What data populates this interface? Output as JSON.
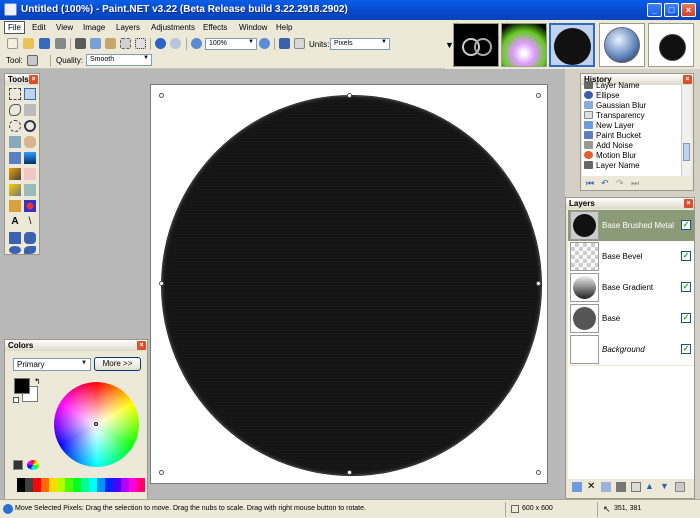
{
  "window": {
    "title": "Untitled (100%) - Paint.NET v3.22 (Beta Release build 3.22.2918.2902)"
  },
  "menu": [
    "File",
    "Edit",
    "View",
    "Image",
    "Layers",
    "Adjustments",
    "Effects",
    "Window",
    "Help"
  ],
  "toolbar": {
    "zoom_value": "100%",
    "units_label": "Units:",
    "units_value": "Pixels",
    "tool_label": "Tool:",
    "quality_label": "Quality:",
    "quality_value": "Smooth"
  },
  "tools_panel": {
    "title": "Tools"
  },
  "colors_panel": {
    "title": "Colors",
    "mode": "Primary",
    "more_button": "More >>",
    "primary_color": "#000000",
    "secondary_color": "#ffffff"
  },
  "history_panel": {
    "title": "History",
    "items": [
      "Layer Name",
      "Ellipse",
      "Gaussian Blur",
      "Transparency",
      "New Layer",
      "Paint Bucket",
      "Add Noise",
      "Motion Blur",
      "Layer Name"
    ]
  },
  "layers_panel": {
    "title": "Layers",
    "layers": [
      {
        "name": "Base Brushed Metal",
        "visible": true,
        "selected": true
      },
      {
        "name": "Base Bevel",
        "visible": true,
        "selected": false
      },
      {
        "name": "Base Gradient",
        "visible": true,
        "selected": false
      },
      {
        "name": "Base",
        "visible": true,
        "selected": false
      },
      {
        "name": "Background",
        "visible": true,
        "selected": false
      }
    ]
  },
  "status": {
    "message": "Move Selected Pixels: Drag the selection to move. Drag the nubs to scale. Drag with right mouse button to rotate.",
    "image_size": "600 x 600",
    "cursor_position": "351, 381"
  }
}
